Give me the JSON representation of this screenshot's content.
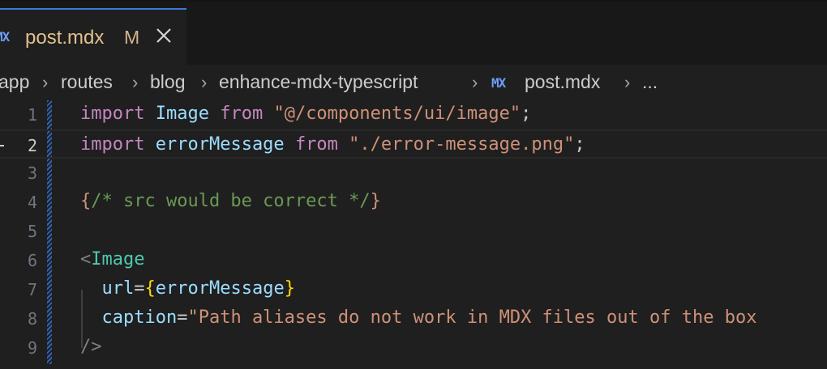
{
  "tab": {
    "icon": "mdx-icon",
    "icon_text": "MX",
    "file_name": "post.mdx",
    "modified_badge": "M"
  },
  "breadcrumb": {
    "items": [
      "app",
      "routes",
      "blog",
      "enhance-mdx-typescript"
    ],
    "file_icon_text": "MX",
    "file_name": "post.mdx",
    "more": "..."
  },
  "editor": {
    "current_line": 2,
    "line_numbers": [
      "1",
      "2",
      "3",
      "4",
      "5",
      "6",
      "7",
      "8",
      "9"
    ],
    "lines": [
      {
        "tokens": [
          {
            "t": "import",
            "c": "kw"
          },
          {
            "t": " ",
            "c": "punc"
          },
          {
            "t": "Image",
            "c": "id"
          },
          {
            "t": " ",
            "c": "punc"
          },
          {
            "t": "from",
            "c": "kw"
          },
          {
            "t": " ",
            "c": "punc"
          },
          {
            "t": "\"@/components/ui/image\"",
            "c": "str"
          },
          {
            "t": ";",
            "c": "punc"
          }
        ]
      },
      {
        "tokens": [
          {
            "t": "import",
            "c": "kw"
          },
          {
            "t": " ",
            "c": "punc"
          },
          {
            "t": "errorMessage",
            "c": "id"
          },
          {
            "t": " ",
            "c": "punc"
          },
          {
            "t": "from",
            "c": "kw"
          },
          {
            "t": " ",
            "c": "punc"
          },
          {
            "t": "\"./error-message.png\"",
            "c": "str"
          },
          {
            "t": ";",
            "c": "punc"
          }
        ]
      },
      {
        "tokens": []
      },
      {
        "tokens": [
          {
            "t": "{",
            "c": "str"
          },
          {
            "t": "/* src would be correct */",
            "c": "cmt"
          },
          {
            "t": "}",
            "c": "str"
          }
        ]
      },
      {
        "tokens": []
      },
      {
        "tokens": [
          {
            "t": "<",
            "c": "tagb"
          },
          {
            "t": "Image",
            "c": "tag"
          }
        ]
      },
      {
        "tokens": [
          {
            "t": "  ",
            "c": "punc"
          },
          {
            "t": "url",
            "c": "attr"
          },
          {
            "t": "=",
            "c": "punc"
          },
          {
            "t": "{",
            "c": "brace"
          },
          {
            "t": "errorMessage",
            "c": "id"
          },
          {
            "t": "}",
            "c": "brace"
          }
        ]
      },
      {
        "tokens": [
          {
            "t": "  ",
            "c": "punc"
          },
          {
            "t": "caption",
            "c": "attr"
          },
          {
            "t": "=",
            "c": "punc"
          },
          {
            "t": "\"Path aliases do not work in MDX files out of the box",
            "c": "str"
          }
        ]
      },
      {
        "tokens": [
          {
            "t": "/>",
            "c": "tagb"
          }
        ]
      }
    ]
  }
}
